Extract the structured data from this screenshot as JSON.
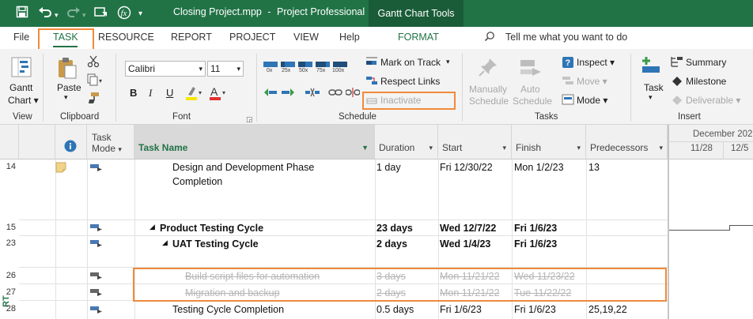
{
  "title_bar": {
    "file_title": "Closing Project.mpp",
    "separator": "-",
    "app_name": "Project Professional",
    "context_tab": "Gantt Chart Tools"
  },
  "tabs": [
    {
      "label": "File"
    },
    {
      "label": "TASK"
    },
    {
      "label": "RESOURCE"
    },
    {
      "label": "REPORT"
    },
    {
      "label": "PROJECT"
    },
    {
      "label": "VIEW"
    },
    {
      "label": "Help"
    },
    {
      "label": "FORMAT"
    }
  ],
  "tell_me": "Tell me what you want to do",
  "ribbon": {
    "view": {
      "gantt_line1": "Gantt",
      "gantt_line2": "Chart",
      "label": "View"
    },
    "clipboard": {
      "paste": "Paste",
      "label": "Clipboard"
    },
    "font": {
      "name": "Calibri",
      "size": "11",
      "bold": "B",
      "italic": "I",
      "underline": "U",
      "label": "Font"
    },
    "schedule": {
      "pct": [
        "0x",
        "25x",
        "50x",
        "75x",
        "100x"
      ],
      "mark_on_track": "Mark on Track",
      "respect_links": "Respect Links",
      "inactivate": "Inactivate",
      "label": "Schedule"
    },
    "tasks": {
      "manually_line1": "Manually",
      "manually_line2": "Schedule",
      "auto_line1": "Auto",
      "auto_line2": "Schedule",
      "inspect": "Inspect",
      "move": "Move",
      "mode": "Mode",
      "label": "Tasks"
    },
    "insert": {
      "task": "Task",
      "summary": "Summary",
      "milestone": "Milestone",
      "deliverable": "Deliverable",
      "label": "Insert"
    }
  },
  "columns": {
    "mode_line1": "Task",
    "mode_line2": "Mode",
    "task_name": "Task Name",
    "duration": "Duration",
    "start": "Start",
    "finish": "Finish",
    "predecessors": "Predecessors"
  },
  "timescale": {
    "month": "December 202",
    "w1": "11/28",
    "w2": "12/5"
  },
  "side_label": "RT",
  "rows": [
    {
      "id": "14",
      "name_line1": "Design and Development Phase",
      "name_line2": "Completion",
      "duration": "1 day",
      "start": "Fri 12/30/22",
      "finish": "Mon 1/2/23",
      "pred": "13"
    },
    {
      "id": "15",
      "name": "Product Testing Cycle",
      "duration": "23 days",
      "start": "Wed 12/7/22",
      "finish": "Fri 1/6/23",
      "pred": ""
    },
    {
      "id": "23",
      "name": "UAT Testing Cycle",
      "duration": "2 days",
      "start": "Wed 1/4/23",
      "finish": "Fri 1/6/23",
      "pred": ""
    },
    {
      "id": "26",
      "name": "Build script files for automation",
      "duration": "3 days",
      "start": "Mon 11/21/22",
      "finish": "Wed 11/23/22",
      "pred": ""
    },
    {
      "id": "27",
      "name": "Migration and backup ",
      "duration": "2 days",
      "start": "Mon 11/21/22",
      "finish": "Tue 11/22/22",
      "pred": ""
    },
    {
      "id": "28",
      "name": "Testing Cycle Completion",
      "duration": "0.5 days",
      "start": "Fri 1/6/23",
      "finish": "Fri 1/6/23",
      "pred": "25,19,22"
    }
  ],
  "colors": {
    "brand": "#217346",
    "highlight": "#f08a3c"
  }
}
